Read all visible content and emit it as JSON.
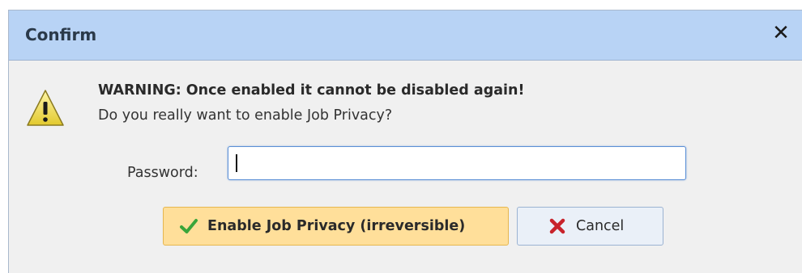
{
  "dialog": {
    "title": "Confirm",
    "close_symbol": "✕"
  },
  "message": {
    "icon": "warning-icon",
    "warning": "WARNING: Once enabled it cannot be disabled again!",
    "question": "Do you really want to enable Job Privacy?"
  },
  "password": {
    "label": "Password:",
    "value": ""
  },
  "buttons": {
    "enable": {
      "label": "Enable Job Privacy (irreversible)",
      "icon": "checkmark-icon"
    },
    "cancel": {
      "label": "Cancel",
      "icon": "x-icon"
    }
  },
  "colors": {
    "titlebar": "#b8d3f5",
    "body": "#f0f0f0",
    "enable_button": "#ffdf9a",
    "cancel_button": "#eaf0f8",
    "check": "#3aa53a",
    "cross": "#c8232b"
  }
}
